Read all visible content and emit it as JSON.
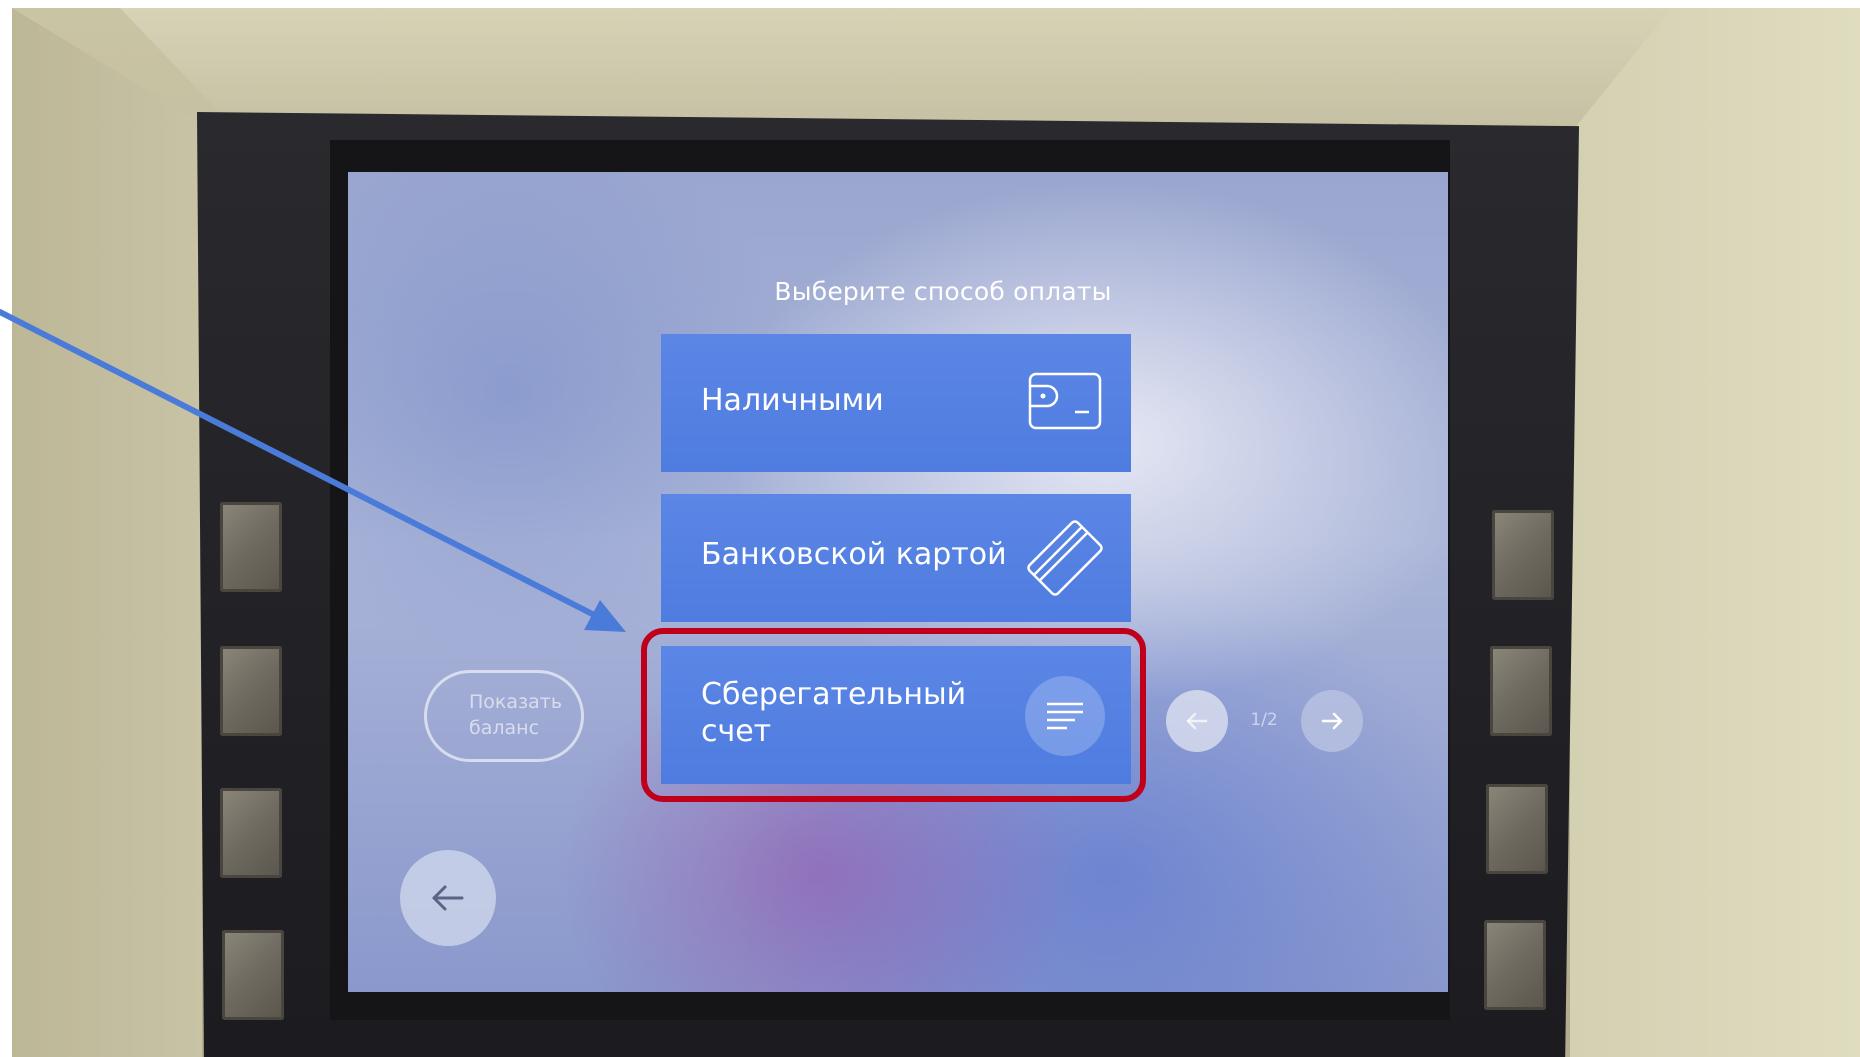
{
  "screen": {
    "title": "Выберите способ оплаты",
    "options": [
      {
        "label": "Наличными",
        "icon": "wallet-icon"
      },
      {
        "label": "Банковской картой",
        "icon": "card-icon"
      },
      {
        "label": "Сберегательный счет",
        "icon": "document-lines-icon"
      }
    ],
    "balance_button": "Показать баланс",
    "back_icon": "arrow-left-icon",
    "pager": {
      "count": "1/2",
      "prev_icon": "arrow-left-icon",
      "next_icon": "arrow-right-icon"
    }
  },
  "annotation": {
    "highlight_color": "#c0001a",
    "pointer_arrow_color": "#4b7bd9"
  },
  "colors": {
    "option_bg": "#5580e3",
    "bezel": "#1f1f23"
  }
}
